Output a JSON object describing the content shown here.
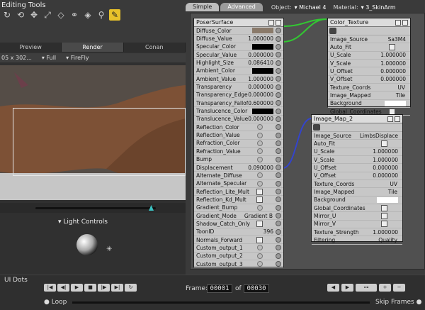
{
  "app": {
    "editing_title": "Editing Tools",
    "tools": [
      "rotate",
      "twist",
      "translate",
      "scale",
      "taper",
      "chain",
      "color",
      "magnify",
      "morph",
      "edit"
    ]
  },
  "doc": {
    "tabs": [
      "Preview",
      "Render",
      "Conan"
    ],
    "active_tab": "Render",
    "resolution": "05 x 302...",
    "size_mode": "Full",
    "renderer": "FireFly"
  },
  "light": {
    "label": "Light Controls"
  },
  "ui_dots": "UI Dots",
  "bottom": {
    "frame_label": "Frame:",
    "current_frame": "00001",
    "of": "of",
    "total_frames": "00030",
    "loop": "Loop",
    "skip_frames": "Skip Frames"
  },
  "material": {
    "tabs": [
      "Simple",
      "Advanced"
    ],
    "active_tab": "Advanced",
    "object_label": "Object:",
    "object_value": "Michael 4",
    "material_label": "Material:",
    "material_value": "3_SkinArm"
  },
  "poser_surface": {
    "title": "PoserSurface",
    "rows": [
      {
        "label": "Diffuse_Color",
        "value": "",
        "swatch": "#8a7a6a"
      },
      {
        "label": "Diffuse_Value",
        "value": "1.000000"
      },
      {
        "label": "Specular_Color",
        "value": "",
        "swatch": "#000000"
      },
      {
        "label": "Specular_Value",
        "value": "0.000000"
      },
      {
        "label": "Highlight_Size",
        "value": "0.086410"
      },
      {
        "label": "Ambient_Color",
        "value": "",
        "swatch": "#000000"
      },
      {
        "label": "Ambient_Value",
        "value": "1.000000"
      },
      {
        "label": "Transparency",
        "value": "0.000000"
      },
      {
        "label": "Transparency_Edge",
        "value": "0.000000"
      },
      {
        "label": "Transparency_Falloff",
        "value": "0.600000"
      },
      {
        "label": "Translucence_Color",
        "value": "",
        "swatch": "#000000"
      },
      {
        "label": "Translucence_Value",
        "value": "0.000000"
      },
      {
        "label": "Reflection_Color",
        "value": ""
      },
      {
        "label": "Reflection_Value",
        "value": ""
      },
      {
        "label": "Refraction_Color",
        "value": ""
      },
      {
        "label": "Refraction_Value",
        "value": ""
      },
      {
        "label": "Bump",
        "value": ""
      },
      {
        "label": "Displacement",
        "value": "0.090000"
      },
      {
        "label": "Alternate_Diffuse",
        "value": ""
      },
      {
        "label": "Alternate_Specular",
        "value": ""
      },
      {
        "label": "Reflection_Lite_Mult",
        "value": ""
      },
      {
        "label": "Reflection_Kd_Mult",
        "value": ""
      },
      {
        "label": "Gradient_Bump",
        "value": ""
      },
      {
        "label": "Gradient_Mode",
        "value": "Gradient B"
      },
      {
        "label": "Shadow_Catch_Only",
        "value": ""
      },
      {
        "label": "ToonID",
        "value": "396"
      },
      {
        "label": "Normals_Forward",
        "value": ""
      },
      {
        "label": "Custom_output_1",
        "value": ""
      },
      {
        "label": "Custom_output_2",
        "value": ""
      },
      {
        "label": "Custom_output_3",
        "value": ""
      }
    ]
  },
  "color_texture": {
    "title": "Color_Texture",
    "rows": [
      {
        "label": "Image_Source",
        "value": "Sa3M4"
      },
      {
        "label": "Auto_Fit",
        "value": ""
      },
      {
        "label": "U_Scale",
        "value": "1.000000"
      },
      {
        "label": "V_Scale",
        "value": "1.000000"
      },
      {
        "label": "U_Offset",
        "value": "0.000000"
      },
      {
        "label": "V_Offset",
        "value": "0.000000"
      },
      {
        "label": "Texture_Coords",
        "value": "UV"
      },
      {
        "label": "Image_Mapped",
        "value": "Tile"
      },
      {
        "label": "Background",
        "value": ""
      },
      {
        "label": "Global_Coordinates",
        "value": ""
      }
    ]
  },
  "image_map": {
    "title": "Image_Map_2",
    "rows": [
      {
        "label": "Image_Source",
        "value": "LimbsDisplace"
      },
      {
        "label": "Auto_Fit",
        "value": ""
      },
      {
        "label": "U_Scale",
        "value": "1.000000"
      },
      {
        "label": "V_Scale",
        "value": "1.000000"
      },
      {
        "label": "U_Offset",
        "value": "0.000000"
      },
      {
        "label": "V_Offset",
        "value": "0.000000"
      },
      {
        "label": "Texture_Coords",
        "value": "UV"
      },
      {
        "label": "Image_Mapped",
        "value": "Tile"
      },
      {
        "label": "Background",
        "value": ""
      },
      {
        "label": "Global_Coordinates",
        "value": ""
      },
      {
        "label": "Mirror_U",
        "value": ""
      },
      {
        "label": "Mirror_V",
        "value": ""
      },
      {
        "label": "Texture_Strength",
        "value": "1.000000"
      },
      {
        "label": "Filtering",
        "value": "Quality"
      }
    ]
  },
  "colors": {
    "accent_yellow": "#e8c22a",
    "scrub_thumb": "#3bc1c1",
    "wire_green": "#32c832",
    "wire_blue": "#3344cc"
  }
}
